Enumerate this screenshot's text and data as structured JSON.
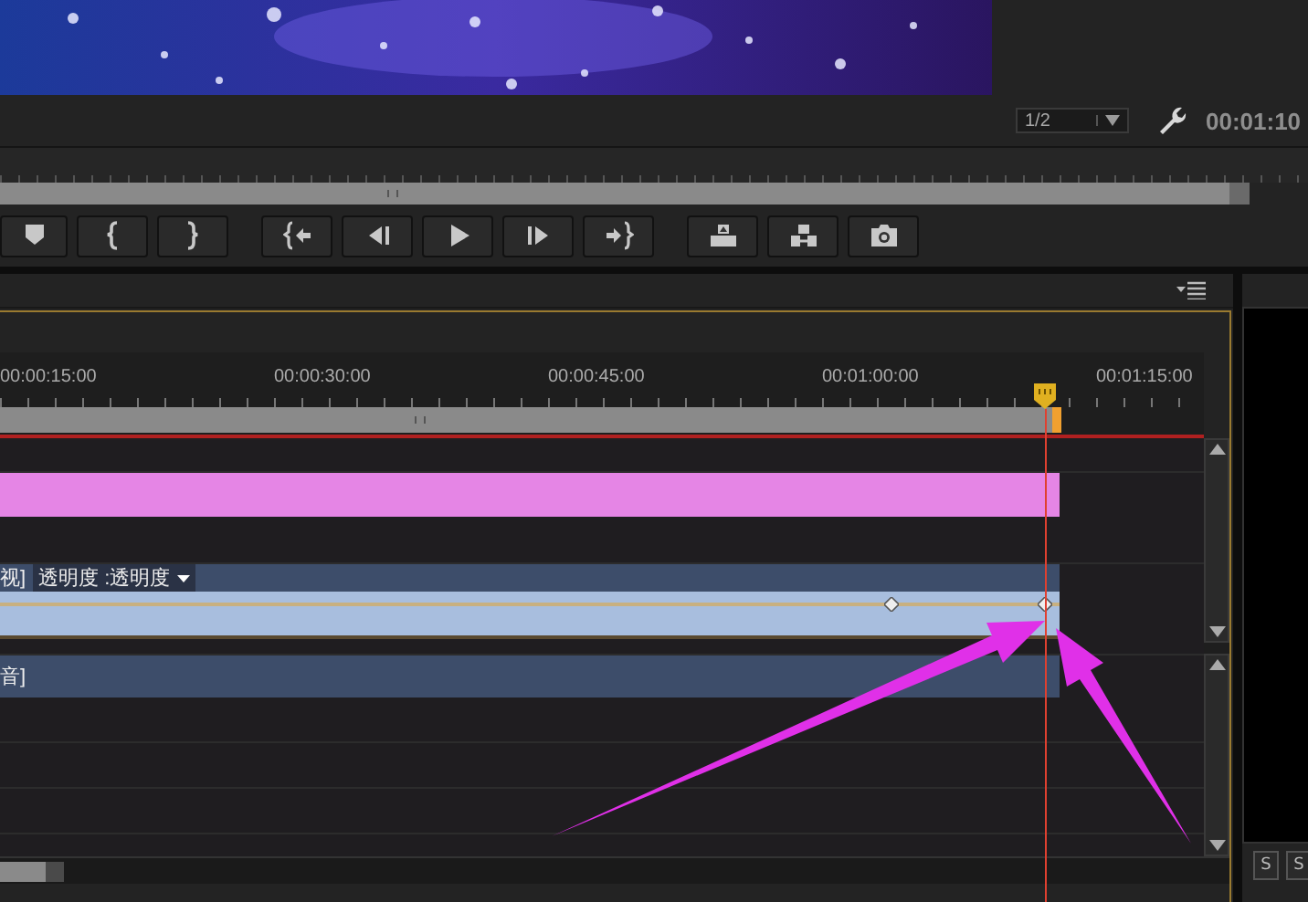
{
  "monitor_bar": {
    "zoom": "1/2",
    "timecode": "00:01:10"
  },
  "timeline": {
    "ruler": [
      "00:00:15:00",
      "00:00:30:00",
      "00:00:45:00",
      "00:01:00:00",
      "00:01:15:00"
    ],
    "tracks": [
      {
        "kind": "video-clip"
      },
      {
        "kind": "effect-clip",
        "label": "视]",
        "property": "透明度 :透明度"
      },
      {
        "kind": "audio-clip",
        "label": "音]"
      }
    ]
  },
  "right_panel": {
    "buttons": [
      "S",
      "S"
    ]
  }
}
